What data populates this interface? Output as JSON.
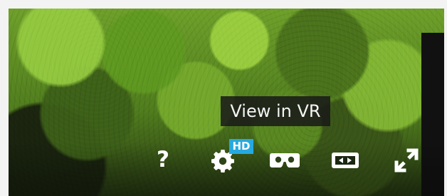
{
  "tooltip": {
    "text": "View in VR"
  },
  "controls": {
    "help": {
      "label": "?",
      "icon": "help-icon"
    },
    "settings": {
      "icon": "gear-icon",
      "badge": "HD"
    },
    "vr": {
      "icon": "vr-headset-icon"
    },
    "theater": {
      "icon": "theater-mode-icon"
    },
    "fullscreen": {
      "icon": "fullscreen-icon"
    }
  },
  "colors": {
    "accent": "#26a9e0",
    "icon": "#ffffff",
    "tooltip_bg": "#191919"
  }
}
